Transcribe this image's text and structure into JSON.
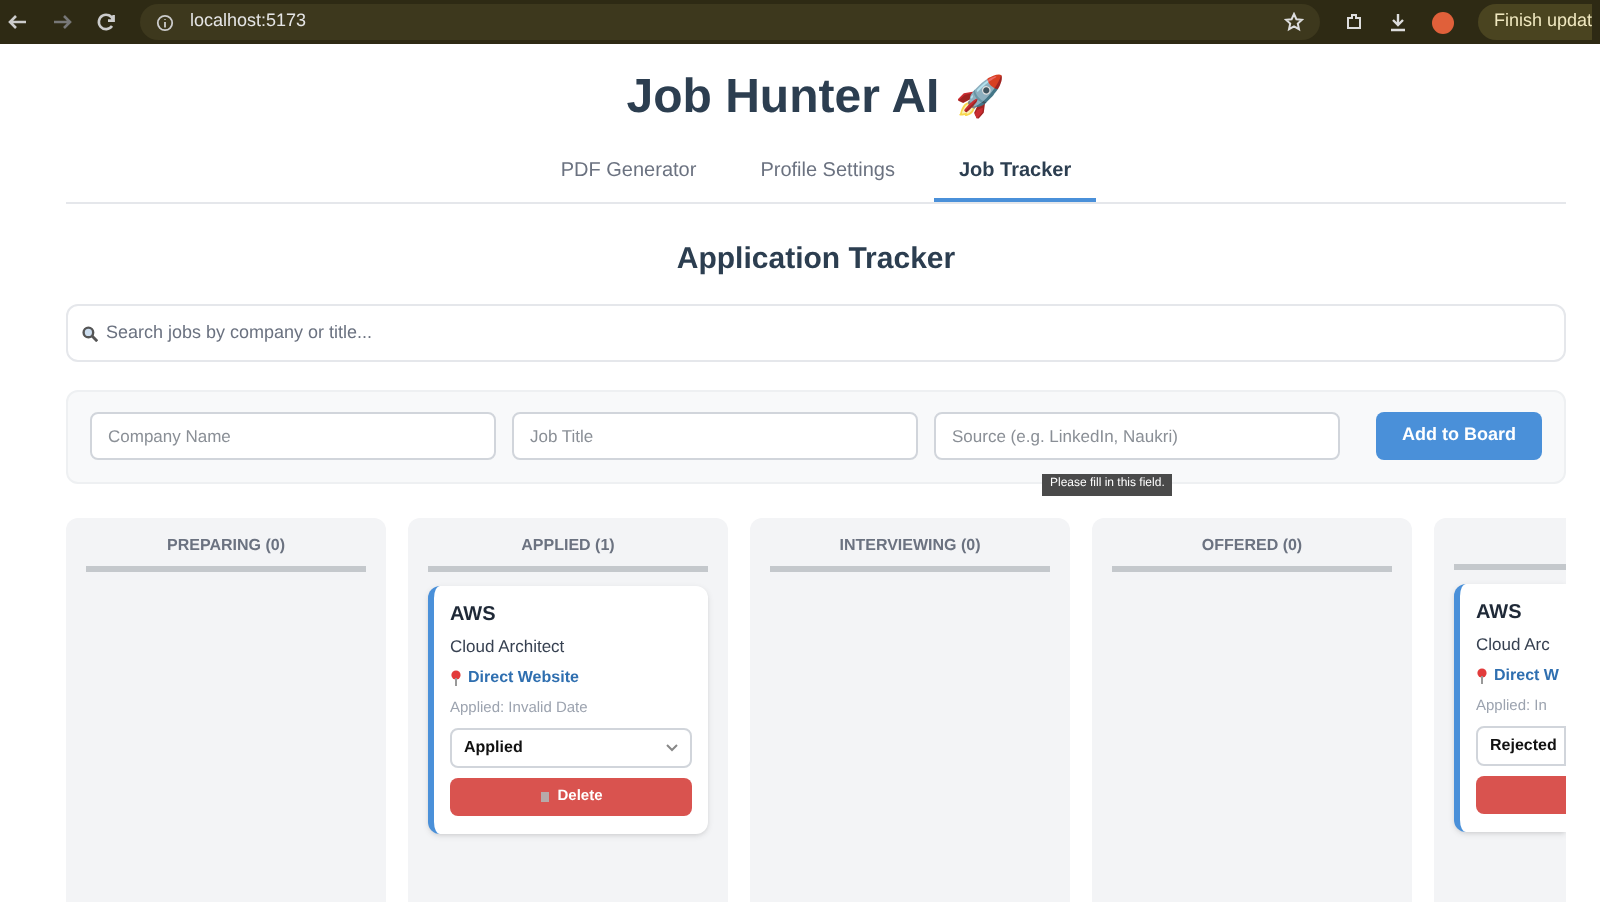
{
  "browser": {
    "url": "localhost:5173",
    "update_button": "Finish updat"
  },
  "app": {
    "title": "Job Hunter AI",
    "title_emoji": "🚀"
  },
  "tabs": [
    {
      "label": "PDF Generator",
      "selected": false
    },
    {
      "label": "Profile Settings",
      "selected": false
    },
    {
      "label": "Job Tracker",
      "selected": true
    }
  ],
  "tracker": {
    "heading": "Application Tracker",
    "search": {
      "placeholder": "Search jobs by company or title..."
    },
    "form": {
      "fields": [
        {
          "placeholder": "Company Name"
        },
        {
          "placeholder": "Job Title"
        },
        {
          "placeholder": "Source (e.g. LinkedIn, Naukri)"
        }
      ],
      "submit": "Add to Board",
      "tooltip": "Please fill in this field."
    }
  },
  "columns": [
    {
      "title": "PREPARING (0)"
    },
    {
      "title": "APPLIED (1)",
      "cards": [
        {
          "company": "AWS",
          "role": "Cloud Architect",
          "source": "Direct Website",
          "applied": "Applied: Invalid Date",
          "status": "Applied",
          "delete": "Delete"
        }
      ]
    },
    {
      "title": "INTERVIEWING (0)"
    },
    {
      "title": "OFFERED (0)"
    },
    {
      "kind": "partial",
      "cards": [
        {
          "company": "AWS",
          "role": "Cloud Arc",
          "source": "Direct W",
          "applied": "Applied: In",
          "status": "Rejected"
        }
      ]
    }
  ]
}
